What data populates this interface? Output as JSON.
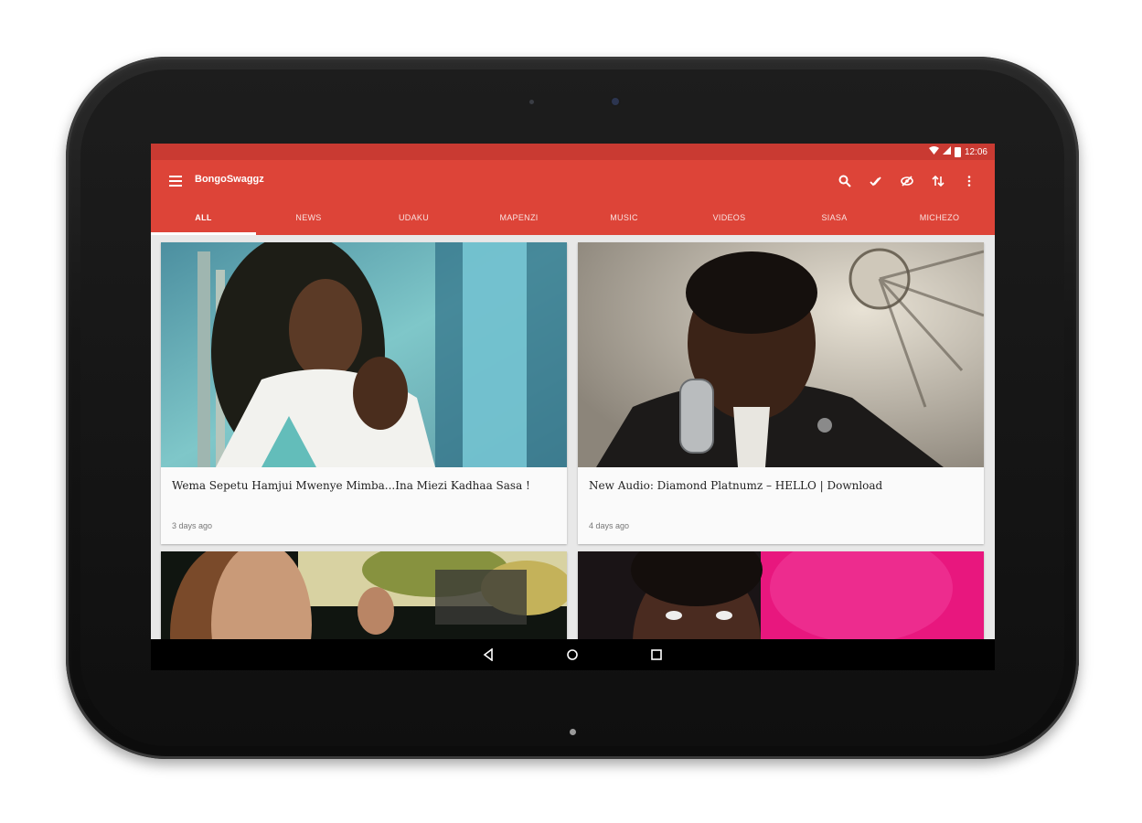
{
  "status_bar": {
    "time": "12:06",
    "wifi_icon": "wifi-icon",
    "signal_icon": "signal-icon",
    "battery_icon": "battery-icon"
  },
  "app_bar": {
    "title": "BongoSwaggz",
    "menu_icon": "menu-icon",
    "actions": [
      "search-icon",
      "done-all-icon",
      "visibility-off-icon",
      "sort-icon",
      "more-vert-icon"
    ],
    "color": "#dd4438"
  },
  "tabs": [
    "ALL",
    "NEWS",
    "UDAKU",
    "MAPENZI",
    "MUSIC",
    "VIDEOS",
    "SIASA",
    "MICHEZO"
  ],
  "active_tab": "ALL",
  "cards": [
    {
      "title": "Wema Sepetu Hamjui Mwenye Mimba...Ina Miezi Kadhaa Sasa !",
      "time": "3 days ago"
    },
    {
      "title": "New Audio: Diamond Platnumz – HELLO | Download",
      "time": "4 days ago"
    },
    {
      "title": "",
      "time": ""
    },
    {
      "title": "",
      "time": ""
    }
  ],
  "nav_bar": [
    "back-icon",
    "home-icon",
    "recents-icon"
  ]
}
